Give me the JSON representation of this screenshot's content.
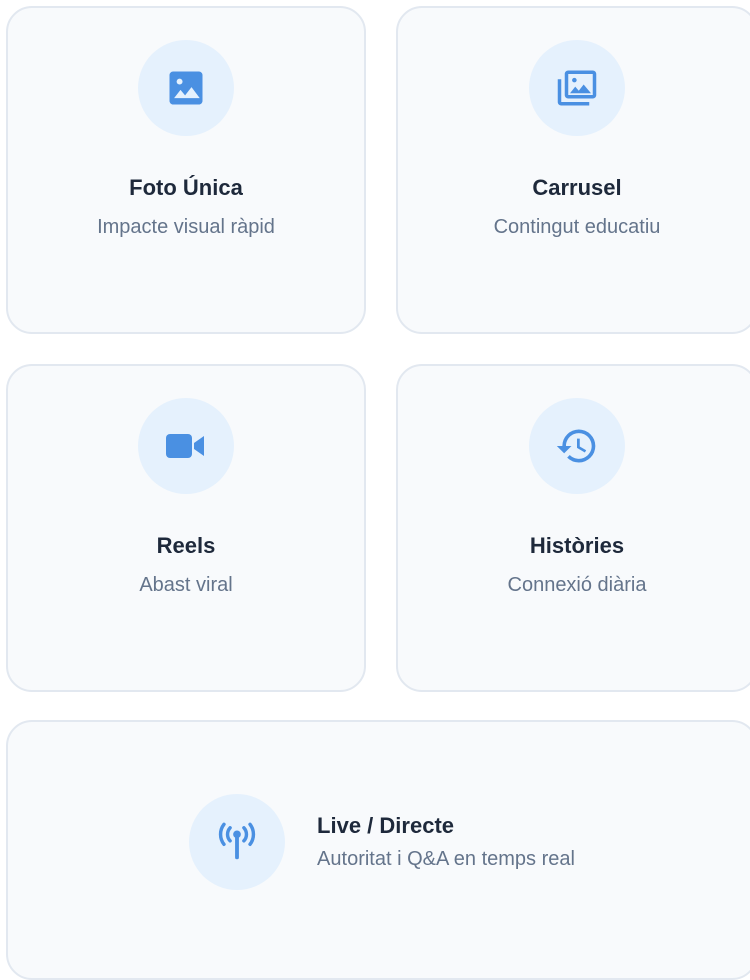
{
  "accent_color": "#4a90e2",
  "cards": [
    {
      "icon": "image-icon",
      "title": "Foto Única",
      "subtitle": "Impacte visual ràpid"
    },
    {
      "icon": "photo-library-icon",
      "title": "Carrusel",
      "subtitle": "Contingut educatiu"
    },
    {
      "icon": "videocam-icon",
      "title": "Reels",
      "subtitle": "Abast viral"
    },
    {
      "icon": "history-icon",
      "title": "Històries",
      "subtitle": "Connexió diària"
    },
    {
      "icon": "antenna-icon",
      "title": "Live / Directe",
      "subtitle": "Autoritat i Q&A en temps real"
    }
  ]
}
